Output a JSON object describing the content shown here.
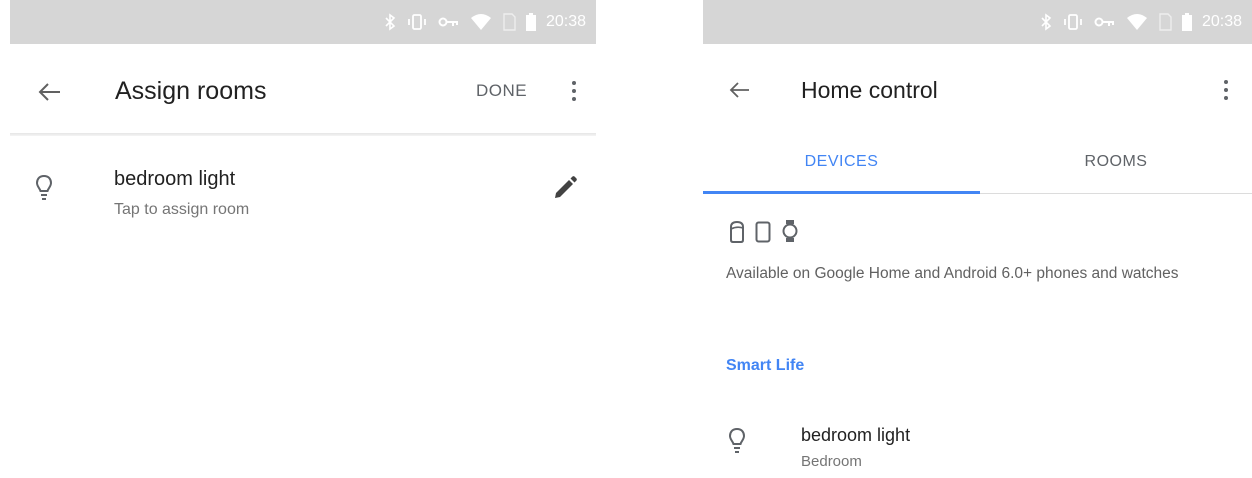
{
  "left_screen": {
    "status_bar": {
      "time": "20:38"
    },
    "appbar": {
      "title": "Assign rooms",
      "done_label": "DONE"
    },
    "device": {
      "name": "bedroom light",
      "subtitle": "Tap to assign room"
    }
  },
  "right_screen": {
    "status_bar": {
      "time": "20:38"
    },
    "appbar": {
      "title": "Home control"
    },
    "tabs": [
      {
        "label": "DEVICES",
        "active": true
      },
      {
        "label": "ROOMS",
        "active": false
      }
    ],
    "availability_text": "Available on Google Home and Android 6.0+ phones and watches",
    "section_title": "Smart Life",
    "device": {
      "name": "bedroom light",
      "room": "Bedroom"
    }
  },
  "colors": {
    "accent": "#4285f4",
    "status_bar": "#d6d6d6",
    "text_primary": "#212121",
    "text_secondary": "#757575"
  }
}
